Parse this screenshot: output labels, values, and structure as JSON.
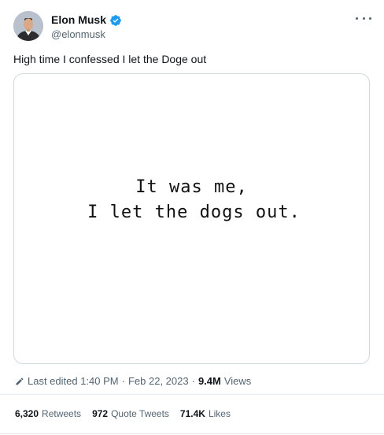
{
  "author": {
    "display_name": "Elon Musk",
    "handle": "@elonmusk",
    "verified": true
  },
  "tweet": {
    "text": "High time I confessed I let the Doge out",
    "media": {
      "line1": "It was me,",
      "line2": "I let the dogs out."
    }
  },
  "meta": {
    "edited_label": "Last edited 1:40 PM",
    "separator": "·",
    "date": "Feb 22, 2023",
    "views_count": "9.4M",
    "views_label": "Views"
  },
  "stats": [
    {
      "count": "6,320",
      "label": "Retweets"
    },
    {
      "count": "972",
      "label": "Quote Tweets"
    },
    {
      "count": "71.4K",
      "label": "Likes"
    }
  ],
  "colors": {
    "text": "#0f1419",
    "secondary": "#536471",
    "verified": "#1d9bf0",
    "border": "#cfd9de"
  },
  "icons": [
    "verified-badge-icon",
    "more-options-icon",
    "pencil-icon"
  ]
}
